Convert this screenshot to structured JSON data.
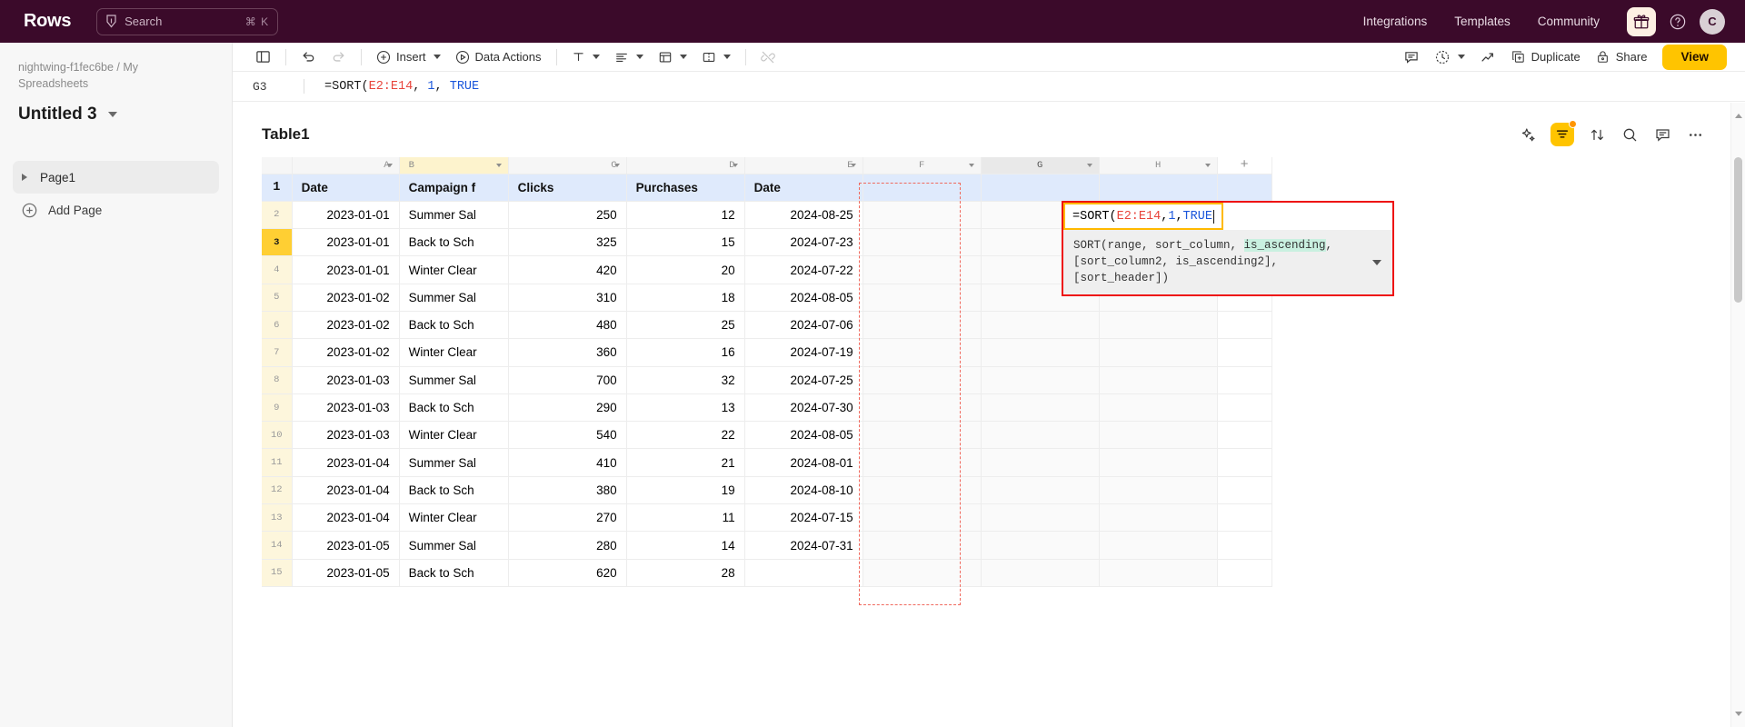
{
  "topbar": {
    "brand": "Rows",
    "search": {
      "placeholder": "Search",
      "shortcut": "⌘ K",
      "icon": "lightning-search-icon"
    },
    "links": [
      {
        "label": "Integrations"
      },
      {
        "label": "Templates"
      },
      {
        "label": "Community"
      }
    ],
    "gift_icon": "gift-icon",
    "help_icon": "help-circle-icon",
    "avatar_initial": "C"
  },
  "sidebar": {
    "breadcrumb": "nightwing-f1fec6be / My Spreadsheets",
    "doc_title": "Untitled 3",
    "pages": [
      {
        "label": "Page1"
      }
    ],
    "add_page_label": "Add Page"
  },
  "toolbar": {
    "panel_icon": "sidebar-panel-icon",
    "undo_icon": "undo-icon",
    "redo_icon": "redo-icon",
    "insert_label": "Insert",
    "data_actions_label": "Data Actions",
    "text_format_icon": "text-format-icon",
    "align_icon": "align-left-icon",
    "table_icon": "table-insert-icon",
    "merge_icon": "merge-cells-icon",
    "link_icon": "unlink-icon",
    "comment_icon": "comment-icon",
    "history_icon": "history-clock-icon",
    "trend_icon": "trending-up-icon",
    "duplicate_label": "Duplicate",
    "share_label": "Share",
    "view_label": "View"
  },
  "formula_bar": {
    "cell_ref": "G3",
    "formula_prefix": "=SORT(",
    "formula_range": "E2:E14",
    "formula_sep1": ", ",
    "formula_num": "1",
    "formula_sep2": ", ",
    "formula_bool": "TRUE"
  },
  "table_panel": {
    "name": "Table1",
    "tools": [
      {
        "name": "ai-sparkle-icon"
      },
      {
        "name": "filter-icon",
        "active": true,
        "badge": true
      },
      {
        "name": "sort-arrows-icon"
      },
      {
        "name": "search-icon"
      },
      {
        "name": "comment-icon"
      },
      {
        "name": "more-options-icon"
      }
    ]
  },
  "formula_editor": {
    "cell": "G3",
    "value_prefix": "=SORT(",
    "value_range": "E2:E14",
    "value_sep1": ", ",
    "value_num": "1",
    "value_sep2": ", ",
    "value_bool": "TRUE",
    "hint_prefix": "SORT(range, sort_column, ",
    "hint_highlight": "is_ascending",
    "hint_suffix": ",",
    "hint_line2": "[sort_column2, is_ascending2], [sort_header])"
  },
  "grid": {
    "columns": [
      "A",
      "B",
      "C",
      "D",
      "E",
      "F",
      "G",
      "H"
    ],
    "selected_column": "B",
    "active_column": "G",
    "active_row": 3,
    "add_column_label": "+",
    "header_row": [
      "Date",
      "Campaign f",
      "Clicks",
      "Purchases",
      "Date",
      "",
      "",
      ""
    ],
    "rows": [
      {
        "n": 2,
        "cells": [
          "2023-01-01",
          "Summer Sal",
          "250",
          "12",
          "2024-08-25",
          "",
          "",
          ""
        ]
      },
      {
        "n": 3,
        "cells": [
          "2023-01-01",
          "Back to Sch",
          "325",
          "15",
          "2024-07-23",
          "",
          "",
          ""
        ]
      },
      {
        "n": 4,
        "cells": [
          "2023-01-01",
          "Winter Clear",
          "420",
          "20",
          "2024-07-22",
          "",
          "",
          ""
        ]
      },
      {
        "n": 5,
        "cells": [
          "2023-01-02",
          "Summer Sal",
          "310",
          "18",
          "2024-08-05",
          "",
          "",
          ""
        ]
      },
      {
        "n": 6,
        "cells": [
          "2023-01-02",
          "Back to Sch",
          "480",
          "25",
          "2024-07-06",
          "",
          "",
          ""
        ]
      },
      {
        "n": 7,
        "cells": [
          "2023-01-02",
          "Winter Clear",
          "360",
          "16",
          "2024-07-19",
          "",
          "",
          ""
        ]
      },
      {
        "n": 8,
        "cells": [
          "2023-01-03",
          "Summer Sal",
          "700",
          "32",
          "2024-07-25",
          "",
          "",
          ""
        ]
      },
      {
        "n": 9,
        "cells": [
          "2023-01-03",
          "Back to Sch",
          "290",
          "13",
          "2024-07-30",
          "",
          "",
          ""
        ]
      },
      {
        "n": 10,
        "cells": [
          "2023-01-03",
          "Winter Clear",
          "540",
          "22",
          "2024-08-05",
          "",
          "",
          ""
        ]
      },
      {
        "n": 11,
        "cells": [
          "2023-01-04",
          "Summer Sal",
          "410",
          "21",
          "2024-08-01",
          "",
          "",
          ""
        ]
      },
      {
        "n": 12,
        "cells": [
          "2023-01-04",
          "Back to Sch",
          "380",
          "19",
          "2024-08-10",
          "",
          "",
          ""
        ]
      },
      {
        "n": 13,
        "cells": [
          "2023-01-04",
          "Winter Clear",
          "270",
          "11",
          "2024-07-15",
          "",
          "",
          ""
        ]
      },
      {
        "n": 14,
        "cells": [
          "2023-01-05",
          "Summer Sal",
          "280",
          "14",
          "2024-07-31",
          "",
          "",
          ""
        ]
      },
      {
        "n": 15,
        "cells": [
          "2023-01-05",
          "Back to Sch",
          "620",
          "28",
          "",
          "",
          "",
          ""
        ]
      }
    ]
  },
  "colors": {
    "brand_dark": "#3b0a2a",
    "accent_yellow": "#ffc400",
    "header_blue": "#dfeafc",
    "row_active": "#ffcf33",
    "range_red": "#e8453c",
    "popup_red": "#ee1111"
  }
}
